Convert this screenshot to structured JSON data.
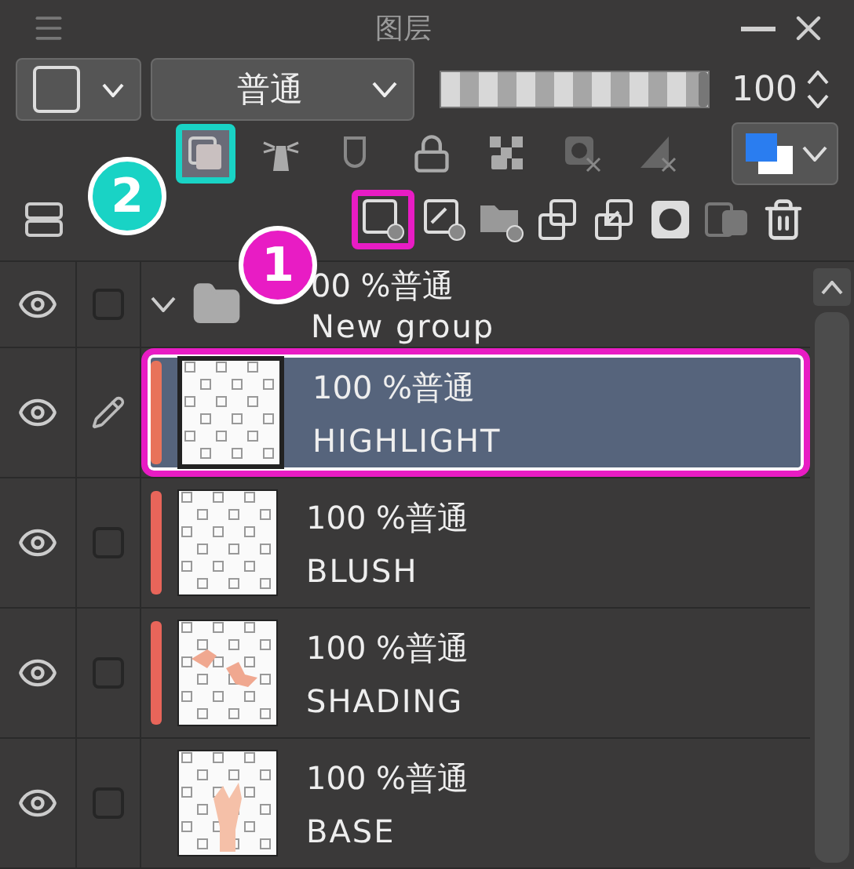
{
  "panel": {
    "title": "图层"
  },
  "blend_mode": {
    "value": "普通"
  },
  "opacity": {
    "level": 1,
    "reading": "100"
  },
  "toolbar": [
    {
      "kind": "reference",
      "on": true
    },
    {
      "kind": "lighthouse",
      "on": false
    },
    {
      "kind": "clip",
      "on": false
    },
    {
      "kind": "lock",
      "on": false
    },
    {
      "kind": "lock-alpha",
      "on": false
    },
    {
      "kind": "mask",
      "on": false
    },
    {
      "kind": "ruler",
      "on": false
    }
  ],
  "actions": [
    {
      "kind": "new-raster",
      "marked": true
    },
    {
      "kind": "new-vector",
      "marked": false
    },
    {
      "kind": "new-folder",
      "marked": false
    },
    {
      "kind": "transfer",
      "marked": false
    },
    {
      "kind": "merge",
      "marked": false
    },
    {
      "kind": "mask",
      "marked": false
    },
    {
      "kind": "apply-mask",
      "marked": false
    },
    {
      "kind": "delete",
      "marked": false
    }
  ],
  "annotations": [
    {
      "label": "2",
      "color": "#19d3c5"
    },
    {
      "label": "1",
      "color": "#e81cc4"
    }
  ],
  "layers": [
    {
      "kind": "folder",
      "mode": "00 %普通",
      "name": "New group",
      "visible": true,
      "selected": false,
      "checked": false,
      "expanded": true
    },
    {
      "kind": "raster",
      "mode": "100 %普通",
      "name": "HIGHLIGHT",
      "visible": true,
      "selected": true,
      "color": "#e8735a"
    },
    {
      "kind": "raster",
      "mode": "100 %普通",
      "name": "BLUSH",
      "visible": true,
      "selected": false,
      "checked": false,
      "color": "#e8655a"
    },
    {
      "kind": "raster",
      "mode": "100 %普通",
      "name": "SHADING",
      "visible": true,
      "selected": false,
      "checked": false,
      "color": "#e8655a"
    },
    {
      "kind": "raster",
      "mode": "100 %普通",
      "name": "BASE",
      "visible": true,
      "selected": false,
      "checked": false
    }
  ]
}
